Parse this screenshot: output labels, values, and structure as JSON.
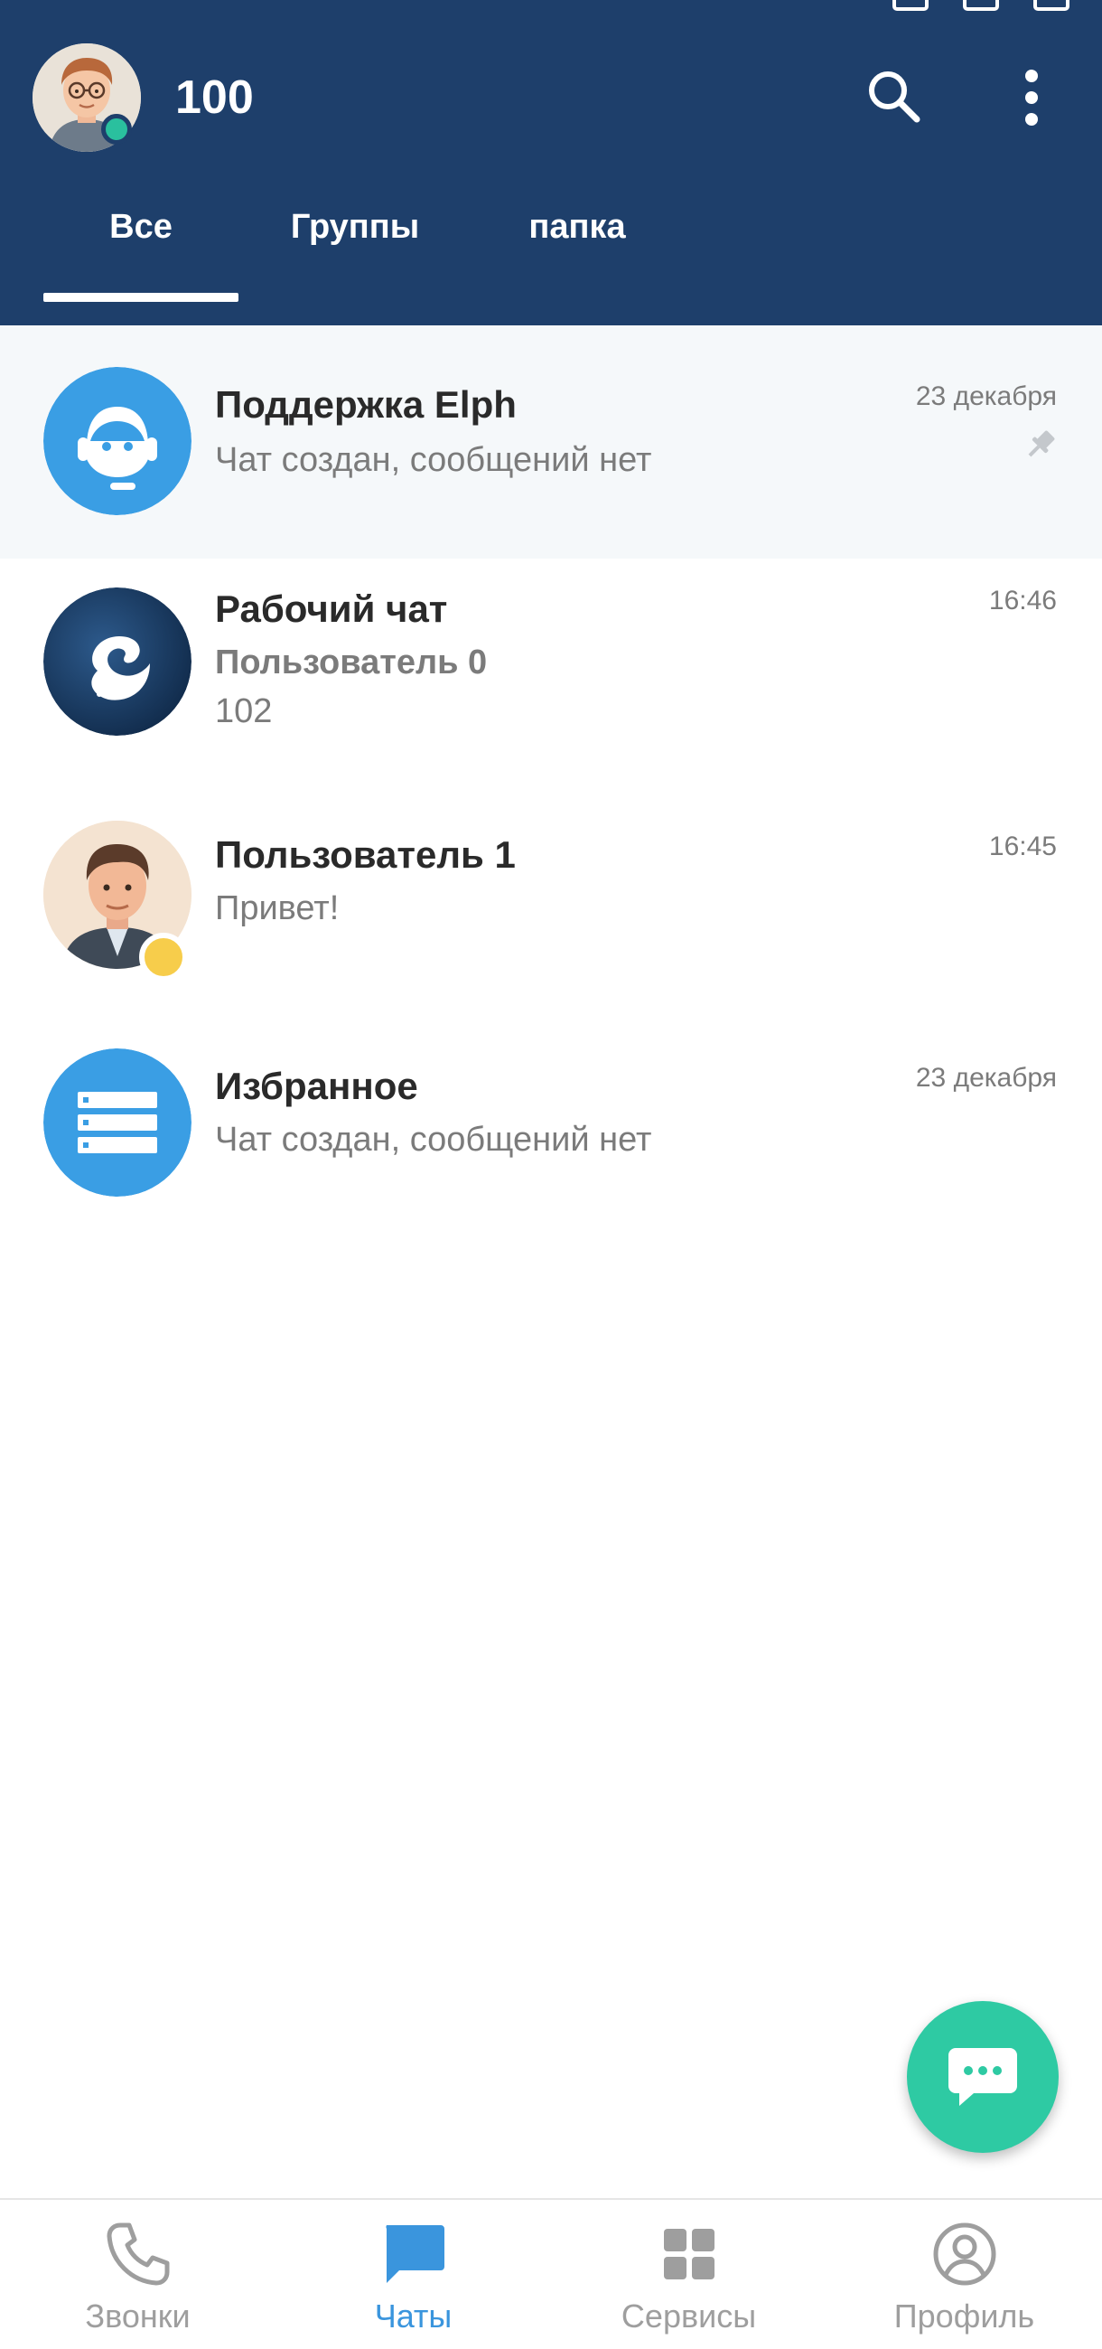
{
  "header": {
    "title": "100",
    "tabs": [
      {
        "label": "Все",
        "active": true
      },
      {
        "label": "Группы",
        "active": false
      },
      {
        "label": "папка",
        "active": false
      }
    ]
  },
  "chats": [
    {
      "name": "Поддержка Elph",
      "preview": "Чат создан, сообщений нет",
      "time": "23 декабря",
      "pinned": true,
      "avatar": "headset-icon",
      "avatar_color": "#3a9ee4"
    },
    {
      "name": "Рабочий чат",
      "sender": "Пользователь 0",
      "preview": "102",
      "time": "16:46",
      "avatar": "elph-logo",
      "avatar_color": "#163559"
    },
    {
      "name": "Пользователь 1",
      "preview": "Привет!",
      "time": "16:45",
      "avatar": "user-avatar",
      "status_color": "#f7cd4b"
    },
    {
      "name": "Избранное",
      "preview": "Чат создан, сообщений нет",
      "time": "23 декабря",
      "avatar": "list-icon",
      "avatar_color": "#3a9ee4"
    }
  ],
  "bottom_nav": [
    {
      "label": "Звонки",
      "icon": "phone-icon",
      "active": false
    },
    {
      "label": "Чаты",
      "icon": "chat-icon",
      "active": true
    },
    {
      "label": "Сервисы",
      "icon": "grid-icon",
      "active": false
    },
    {
      "label": "Профиль",
      "icon": "profile-icon",
      "active": false
    }
  ],
  "colors": {
    "header_bg": "#1e3f6b",
    "accent": "#3a95dd",
    "fab": "#2ecaa3",
    "online": "#2ac09e"
  }
}
